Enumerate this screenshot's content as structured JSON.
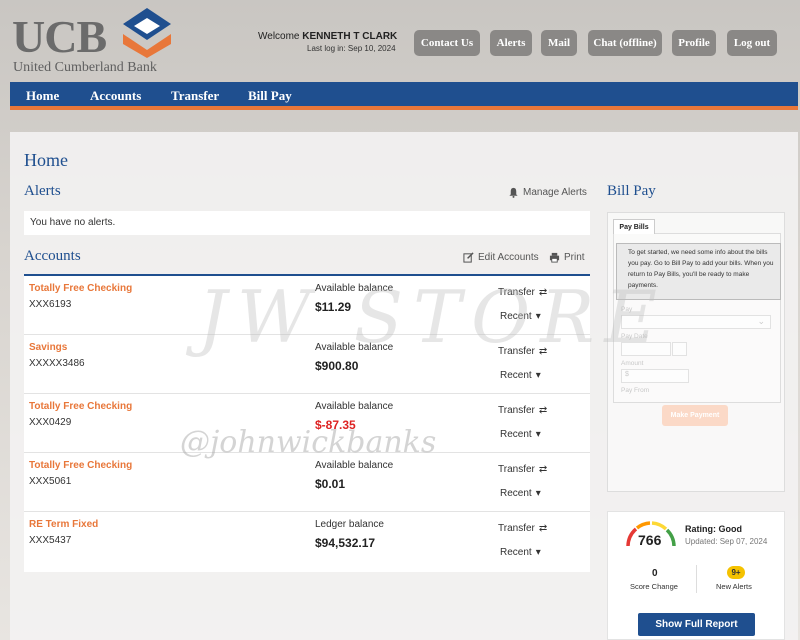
{
  "brand": {
    "abbr": "UCB",
    "name": "United Cumberland Bank",
    "colors": {
      "blue": "#1f4f8f",
      "orange": "#e8773a",
      "gray": "#8a8886"
    }
  },
  "header": {
    "welcome_prefix": "Welcome",
    "user_name": "KENNETH T CLARK",
    "last_login": "Last log in: Sep 10, 2024",
    "buttons": [
      "Contact Us",
      "Alerts",
      "Mail",
      "Chat (offline)",
      "Profile",
      "Log out"
    ]
  },
  "nav": {
    "items": [
      "Home",
      "Accounts",
      "Transfer",
      "Bill Pay"
    ]
  },
  "page_title": "Home",
  "alerts": {
    "title": "Alerts",
    "manage_label": "Manage Alerts",
    "manage_icon": "bell-icon",
    "message": "You have no alerts."
  },
  "accounts": {
    "title": "Accounts",
    "edit_label": "Edit Accounts",
    "edit_icon": "edit-icon",
    "print_label": "Print",
    "print_icon": "printer-icon",
    "transfer_label": "Transfer",
    "transfer_icon": "transfer-arrows-icon",
    "recent_label": "Recent",
    "recent_icon": "chevron-down-icon",
    "rows": [
      {
        "name": "Totally Free Checking",
        "number": "XXX6193",
        "balance_label": "Available balance",
        "balance": "$11.29",
        "negative": false
      },
      {
        "name": "Savings",
        "number": "XXXXX3486",
        "balance_label": "Available balance",
        "balance": "$900.80",
        "negative": false
      },
      {
        "name": "Totally Free Checking",
        "number": "XXX0429",
        "balance_label": "Available balance",
        "balance": "$-87.35",
        "negative": true
      },
      {
        "name": "Totally Free Checking",
        "number": "XXX5061",
        "balance_label": "Available balance",
        "balance": "$0.01",
        "negative": false
      },
      {
        "name": "RE Term Fixed",
        "number": "XXX5437",
        "balance_label": "Ledger balance",
        "balance": "$94,532.17",
        "negative": false
      }
    ]
  },
  "bill_pay": {
    "title": "Bill Pay",
    "tab": "Pay Bills",
    "message": "To get started, we need some info about the bills you pay. Go to Bill Pay to add your bills. When you return to Pay Bills, you'll be ready to make payments.",
    "fields": [
      "Pay",
      "Pay Date",
      "Amount",
      "Pay From"
    ],
    "amount_placeholder": "$",
    "button": "Make Payment"
  },
  "credit": {
    "score": "766",
    "rating": "Rating: Good",
    "updated": "Updated: Sep 07, 2024",
    "score_change": "0",
    "score_change_label": "Score Change",
    "new_alerts": "9+",
    "new_alerts_label": "New Alerts",
    "button": "Show Full Report"
  },
  "watermarks": [
    "JW STORE",
    "@johnwickbanks"
  ]
}
